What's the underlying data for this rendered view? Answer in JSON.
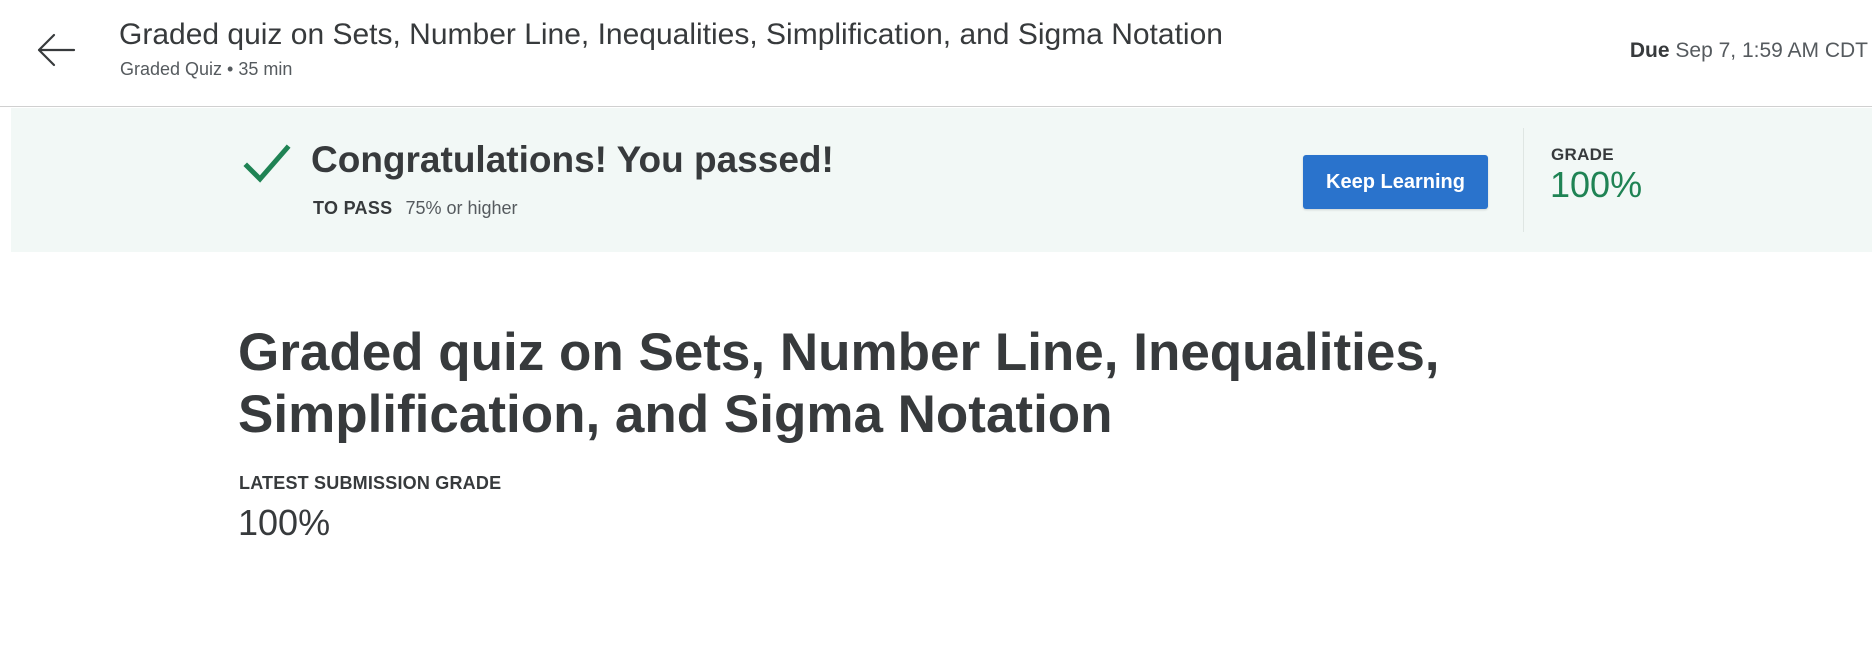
{
  "header": {
    "title": "Graded quiz on Sets, Number Line, Inequalities, Simplification, and Sigma Notation",
    "subtitle": "Graded Quiz • 35 min",
    "due_label": "Due",
    "due_value": "Sep 7, 1:59 AM CDT",
    "back_icon": "arrow-left-icon"
  },
  "banner": {
    "message": "Congratulations! You passed!",
    "to_pass_label": "TO PASS",
    "to_pass_value": "75% or higher",
    "button_label": "Keep Learning",
    "grade_label": "GRADE",
    "grade_value": "100%",
    "check_icon": "checkmark-icon",
    "colors": {
      "banner_bg": "#f2f8f6",
      "success": "#1f8354",
      "button": "#2a73cc"
    }
  },
  "main": {
    "title": "Graded quiz on Sets, Number Line, Inequalities, Simplification, and Sigma Notation",
    "latest_label": "LATEST SUBMISSION GRADE",
    "latest_value": "100%"
  }
}
